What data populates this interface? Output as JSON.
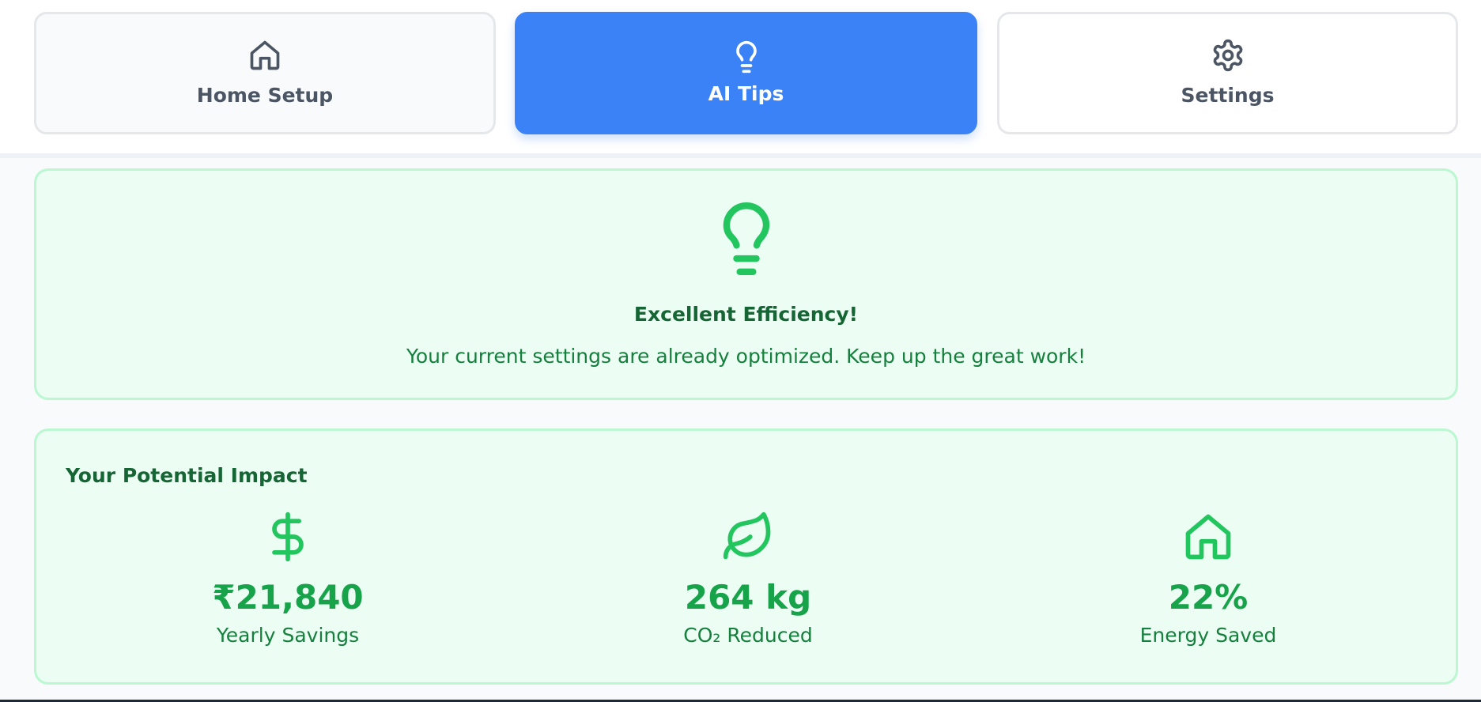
{
  "tabs": [
    {
      "label": "Home Setup",
      "icon": "home-icon",
      "active": false
    },
    {
      "label": "AI Tips",
      "icon": "lightbulb-icon",
      "active": true
    },
    {
      "label": "Settings",
      "icon": "gear-icon",
      "active": false
    }
  ],
  "efficiency": {
    "icon": "lightbulb-icon",
    "title": "Excellent Efficiency!",
    "message": "Your current settings are already optimized. Keep up the great work!"
  },
  "impact": {
    "title": "Your Potential Impact",
    "stats": [
      {
        "icon": "dollar-icon",
        "value": "₹21,840",
        "label": "Yearly Savings"
      },
      {
        "icon": "leaf-icon",
        "value": "264 kg",
        "label": "CO₂ Reduced"
      },
      {
        "icon": "home-icon",
        "value": "22%",
        "label": "Energy Saved"
      }
    ]
  },
  "colors": {
    "accent": "#3b82f6",
    "success": "#22c55e",
    "success_dark": "#166534",
    "card_bg": "#ecfdf3",
    "card_border": "#bbf7d0"
  }
}
